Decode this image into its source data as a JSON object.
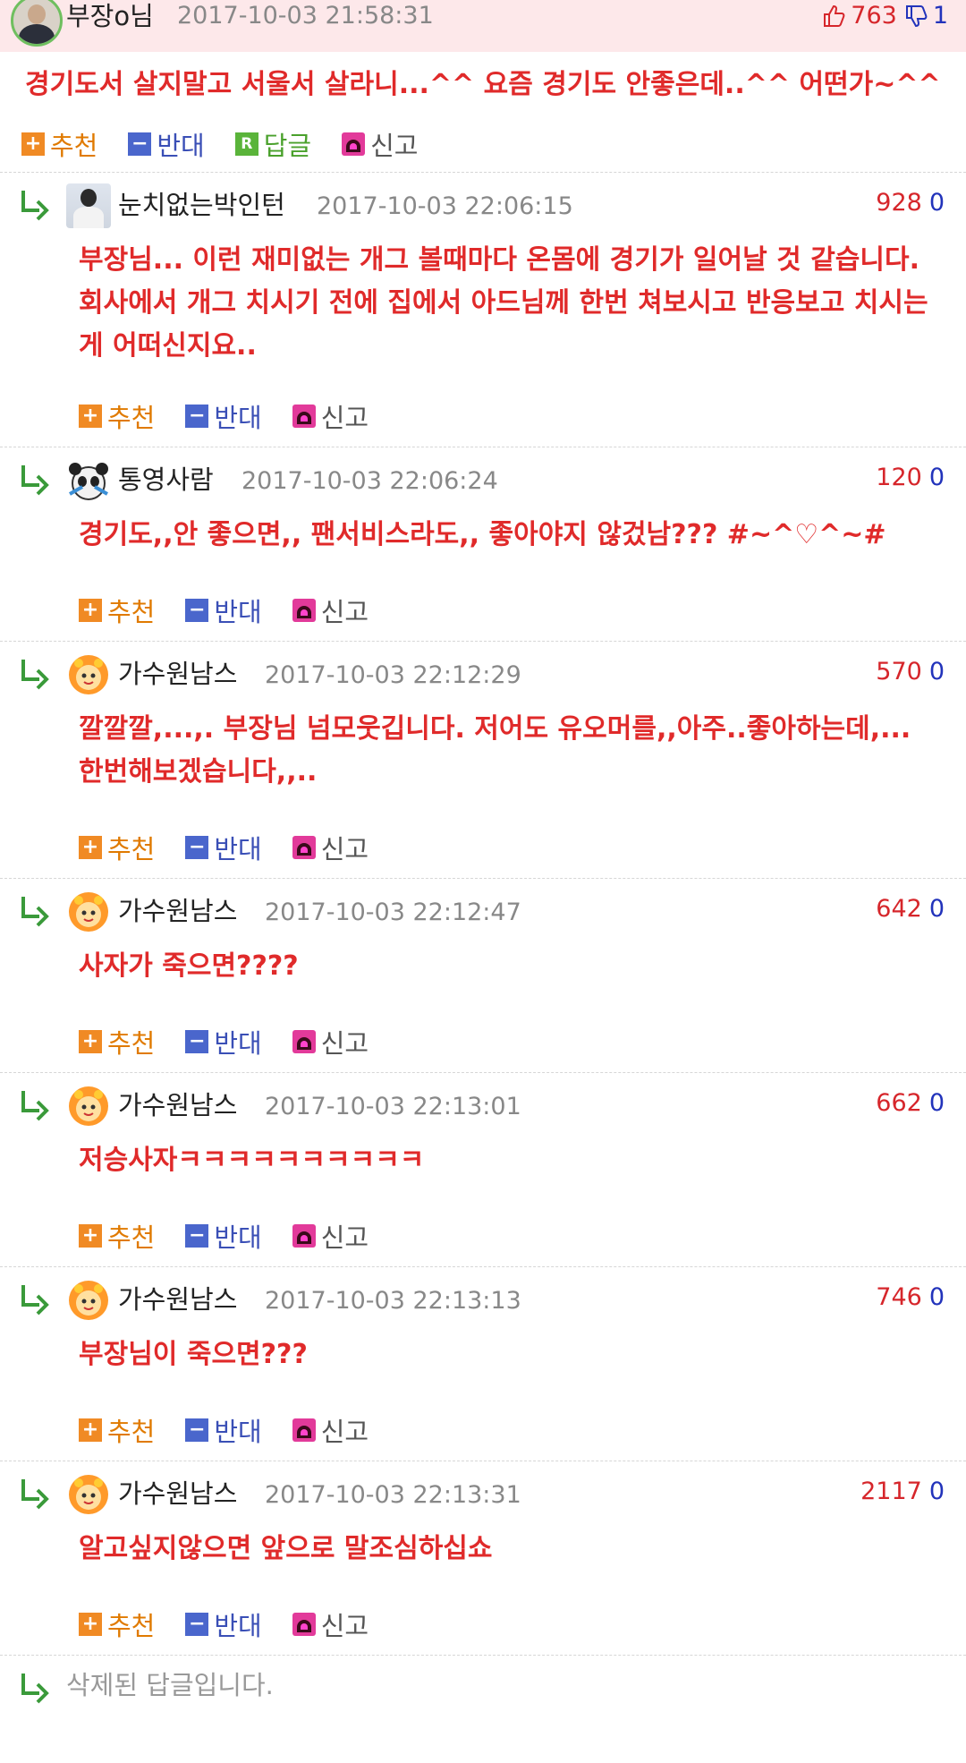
{
  "top": {
    "nick": "부장o님",
    "date": "2017-10-03 21:58:31",
    "up": "763",
    "down": "1",
    "text": "경기도서 살지말고 서울서 살라니...^^ 요즘 경기도 안좋은데..^^ 어떤가~^^",
    "actions": {
      "recommend": "추천",
      "oppose": "반대",
      "reply": "답글",
      "report": "신고",
      "reply_icon": "R"
    }
  },
  "replies": [
    {
      "nick": "눈치없는박인턴",
      "date": "2017-10-03 22:06:15",
      "up": "928",
      "down": "0",
      "text": "부장님... 이런 재미없는 개그 볼때마다 온몸에 경기가 일어날 것 같습니다. 회사에서 개그 치시기 전에 집에서 아드님께 한번 쳐보시고 반응보고 치시는게 어떠신지요..",
      "avatar": "man-photo-icon"
    },
    {
      "nick": "통영사람",
      "date": "2017-10-03 22:06:24",
      "up": "120",
      "down": "0",
      "text": "경기도,,안 좋으면,, 팬서비스라도,, 좋아야지 않겄남??? #~^♡^~#",
      "avatar": "panda-icon"
    },
    {
      "nick": "가수원남스",
      "date": "2017-10-03 22:12:29",
      "up": "570",
      "down": "0",
      "text": "깔깔깔,...,. 부장님 넘모웃깁니다. 저어도 유오머를,,아주..좋아하는데,... 한번해보겠습니다,,..",
      "avatar": "sun-character-icon"
    },
    {
      "nick": "가수원남스",
      "date": "2017-10-03 22:12:47",
      "up": "642",
      "down": "0",
      "text": "사자가 죽으면????",
      "avatar": "sun-character-icon"
    },
    {
      "nick": "가수원남스",
      "date": "2017-10-03 22:13:01",
      "up": "662",
      "down": "0",
      "text": "저승사자ㅋㅋㅋㅋㅋㅋㅋㅋㅋㅋ",
      "avatar": "sun-character-icon"
    },
    {
      "nick": "가수원남스",
      "date": "2017-10-03 22:13:13",
      "up": "746",
      "down": "0",
      "text": "부장님이 죽으면???",
      "avatar": "sun-character-icon"
    },
    {
      "nick": "가수원남스",
      "date": "2017-10-03 22:13:31",
      "up": "2117",
      "down": "0",
      "text": "알고싶지않으면 앞으로 말조심하십쇼",
      "avatar": "sun-character-icon"
    }
  ],
  "reply_actions": {
    "recommend": "추천",
    "oppose": "반대",
    "report": "신고"
  },
  "deleted_text": "삭제된 답글입니다.",
  "colors": {
    "accent_red": "#e02a2a",
    "recommend": "#f08a24",
    "oppose": "#4a66cc",
    "reply": "#5ab43a",
    "report": "#e23a9a",
    "top_bg": "#fde8ea"
  }
}
